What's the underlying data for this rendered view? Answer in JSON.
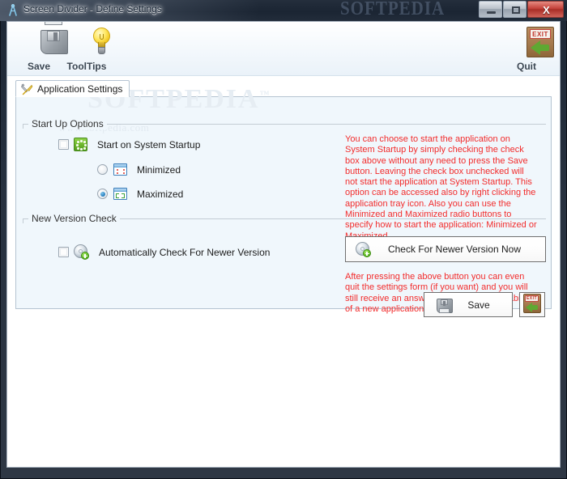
{
  "window": {
    "title": "Screen Divider - Define Settings",
    "title_icon": "divider-compass-icon",
    "watermark": "SOFTPEDIA",
    "controls": {
      "minimize": "minimize-button",
      "maximize": "maximize-button",
      "close_glyph": "X"
    }
  },
  "toolbar": {
    "buttons": [
      {
        "label": "Save",
        "icon": "floppy-disk-icon"
      },
      {
        "label": "ToolTips",
        "icon": "lightbulb-icon"
      },
      {
        "label": "Quit",
        "icon": "exit-door-icon"
      }
    ]
  },
  "tabs": [
    {
      "label": "Application Settings",
      "icon": "tools-icon",
      "active": true
    }
  ],
  "watermarks": {
    "panel_big": "SOFTPEDIA",
    "panel_small": "www.softpedia.com"
  },
  "startup_group": {
    "title": "Start Up Options",
    "checkbox": {
      "label": "Start on System Startup",
      "checked": false,
      "icon": "startup-green-icon"
    },
    "radios": [
      {
        "label": "Minimized",
        "selected": false,
        "icon": "window-minimized-icon"
      },
      {
        "label": "Maximized",
        "selected": true,
        "icon": "window-maximized-icon"
      }
    ],
    "help_text": "You can choose to start the application on System Startup by simply checking the check box above without any need to press the Save button. Leaving the check box unchecked will not start the application at System Startup. This option can be accessed also by right clicking the application tray icon. Also you can use the Minimized and Maximized radio buttons to specify how to start the application: Minimized or Maximized."
  },
  "version_group": {
    "title": "New Version Check",
    "checkbox": {
      "label": "Automatically Check For Newer Version",
      "checked": false,
      "icon": "disc-update-icon"
    },
    "check_button": {
      "label": "Check For Newer Version Now",
      "icon": "disc-update-icon"
    },
    "help_text": "After pressing the above button you can even quit the settings form (if you want) and you will still receive an answer regarding the availability of a new application version."
  },
  "footer": {
    "save_button": {
      "label": "Save",
      "icon": "floppy-disk-icon"
    },
    "exit_button": {
      "label": "",
      "icon": "exit-door-icon"
    }
  },
  "colors": {
    "help_red": "#f22c2c",
    "panel_bg": "#f0f7fc",
    "accent_green": "#6fba2e",
    "radio_blue": "#2f86c4"
  }
}
